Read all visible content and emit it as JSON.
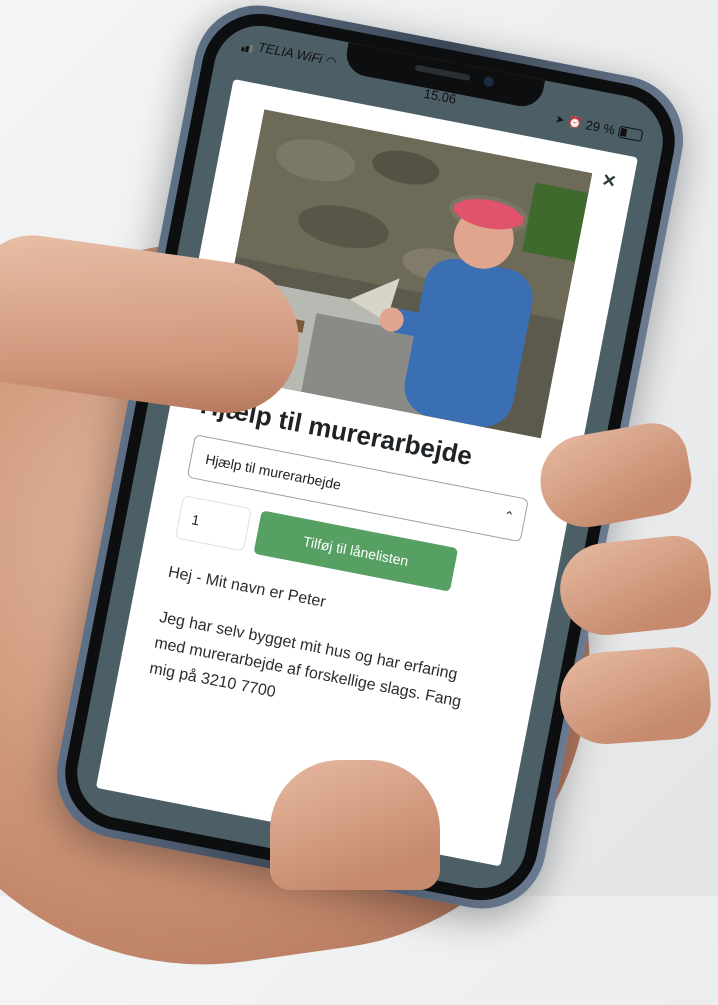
{
  "status_bar": {
    "carrier": "TELIA WiFi",
    "time": "15.06",
    "battery": "29 %"
  },
  "modal": {
    "close_symbol": "×",
    "title": "Hjælp til murerarbejde",
    "variant_select": {
      "selected": "Hjælp til murerarbejde"
    },
    "quantity": "1",
    "add_button_label": "Tilføj til lånelisten",
    "greeting": "Hej - Mit navn er Peter",
    "description": "Jeg har selv bygget mit hus og har erfaring med murerarbejde af forskellige slags. Fang mig på 3210 7700"
  },
  "colors": {
    "accent_green": "#57a064",
    "overlay": "#4d5f66"
  },
  "icons": [
    "wifi-icon",
    "location-icon",
    "alarm-icon",
    "battery-icon",
    "close-icon",
    "select-arrow-icon"
  ]
}
